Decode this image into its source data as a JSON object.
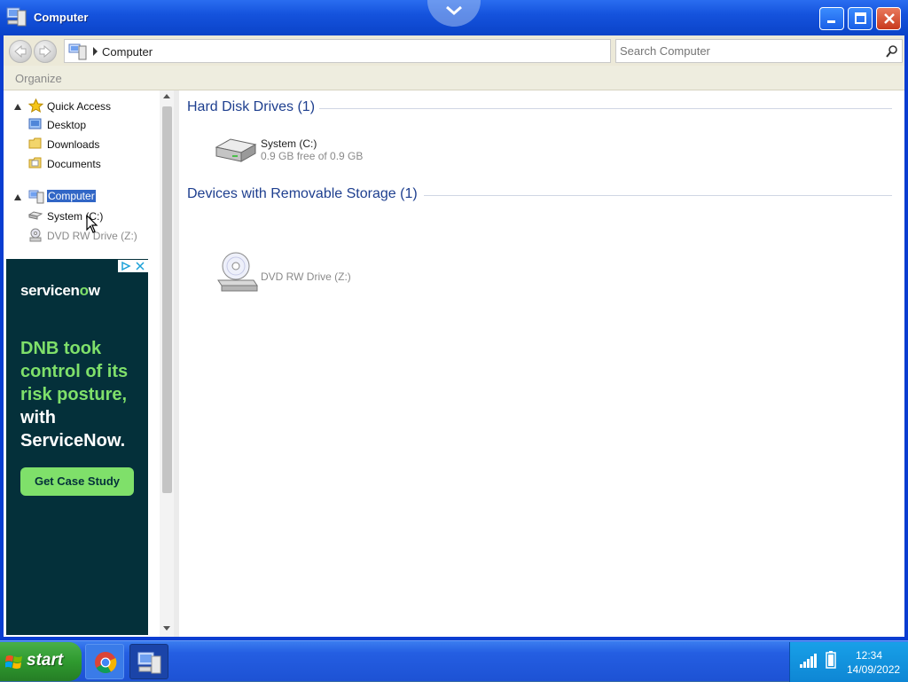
{
  "window": {
    "title": "Computer",
    "controls": {
      "minimize": "minimize",
      "maximize": "maximize",
      "close": "close"
    }
  },
  "address": {
    "path": "Computer",
    "search_placeholder": "Search Computer"
  },
  "toolbar": {
    "organize_label": "Organize"
  },
  "sidebar": {
    "quick_access": {
      "label": "Quick Access",
      "items": [
        {
          "label": "Desktop"
        },
        {
          "label": "Downloads"
        },
        {
          "label": "Documents"
        }
      ]
    },
    "computer": {
      "label": "Computer",
      "items": [
        {
          "label": "System (C:)"
        },
        {
          "label": "DVD RW Drive (Z:)"
        }
      ]
    }
  },
  "ad": {
    "brand_prefix": "servicen",
    "brand_o": "o",
    "brand_suffix": "w",
    "headline_green": "DNB took control of its risk posture,",
    "headline_white": " with ServiceNow.",
    "cta": "Get Case Study"
  },
  "content": {
    "groups": [
      {
        "title": "Hard Disk Drives (1)",
        "items": [
          {
            "name": "System (C:)",
            "detail": "0.9 GB free of 0.9 GB"
          }
        ]
      },
      {
        "title": "Devices with Removable Storage (1)",
        "items": [
          {
            "name": "DVD RW Drive (Z:)",
            "detail": ""
          }
        ]
      }
    ]
  },
  "taskbar": {
    "start_label": "start",
    "time": "12:34",
    "date": "14/09/2022"
  },
  "colors": {
    "titlebar": "#0a43c8",
    "selection": "#3166c6",
    "ad_bg": "#04303a",
    "ad_accent": "#7fe06a",
    "group_heading": "#1e3f8f"
  }
}
